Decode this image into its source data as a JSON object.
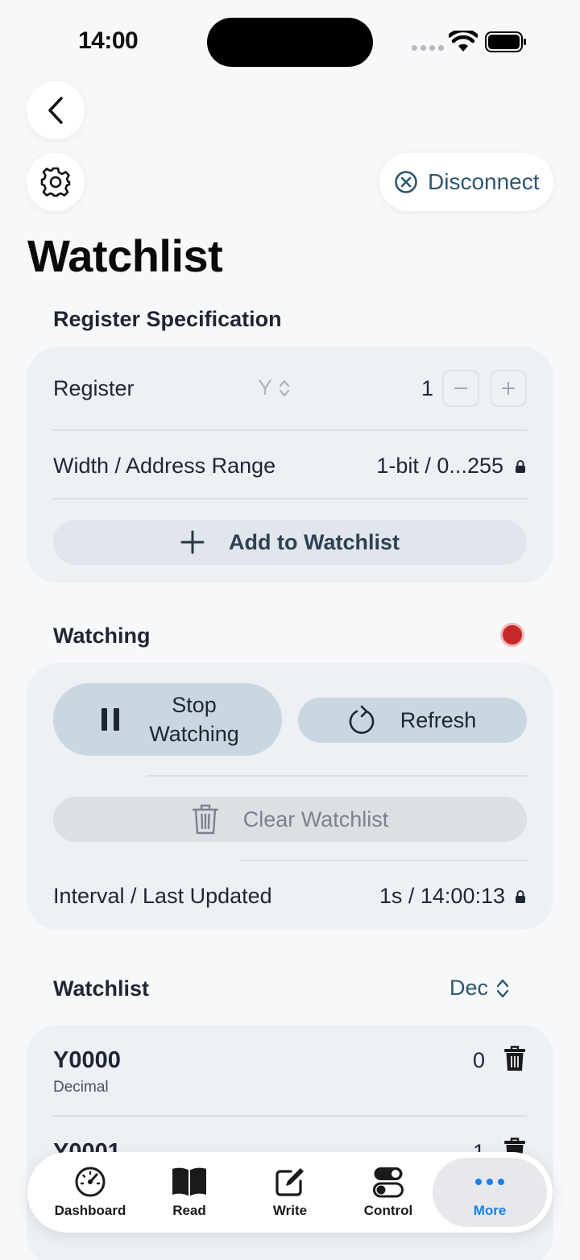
{
  "status": {
    "time": "14:00"
  },
  "header": {
    "disconnect_label": "Disconnect"
  },
  "title": "Watchlist",
  "spec": {
    "heading": "Register Specification",
    "register_label": "Register",
    "register_type": "Y",
    "register_number": "1",
    "width_label": "Width / Address Range",
    "width_value": "1-bit / 0...255",
    "add_label": "Add to Watchlist"
  },
  "watching": {
    "heading": "Watching",
    "indicator_color": "#c62828",
    "stop_label_1": "Stop",
    "stop_label_2": "Watching",
    "refresh_label": "Refresh",
    "clear_label": "Clear Watchlist",
    "interval_label": "Interval / Last Updated",
    "interval_value": "1s / 14:00:13"
  },
  "watchlist": {
    "heading": "Watchlist",
    "format": "Dec",
    "items": [
      {
        "name": "Y0000",
        "format_label": "Decimal",
        "value": "0"
      },
      {
        "name": "Y0001",
        "value": "1"
      }
    ]
  },
  "tabs": [
    {
      "label": "Dashboard",
      "icon": "gauge-icon"
    },
    {
      "label": "Read",
      "icon": "book-icon"
    },
    {
      "label": "Write",
      "icon": "compose-icon"
    },
    {
      "label": "Control",
      "icon": "toggles-icon"
    },
    {
      "label": "More",
      "icon": "ellipsis-icon",
      "active": true
    }
  ],
  "colors": {
    "accent": "#1a7fe8",
    "button_blue": "#cad6e0",
    "destructive": "#c62828"
  }
}
